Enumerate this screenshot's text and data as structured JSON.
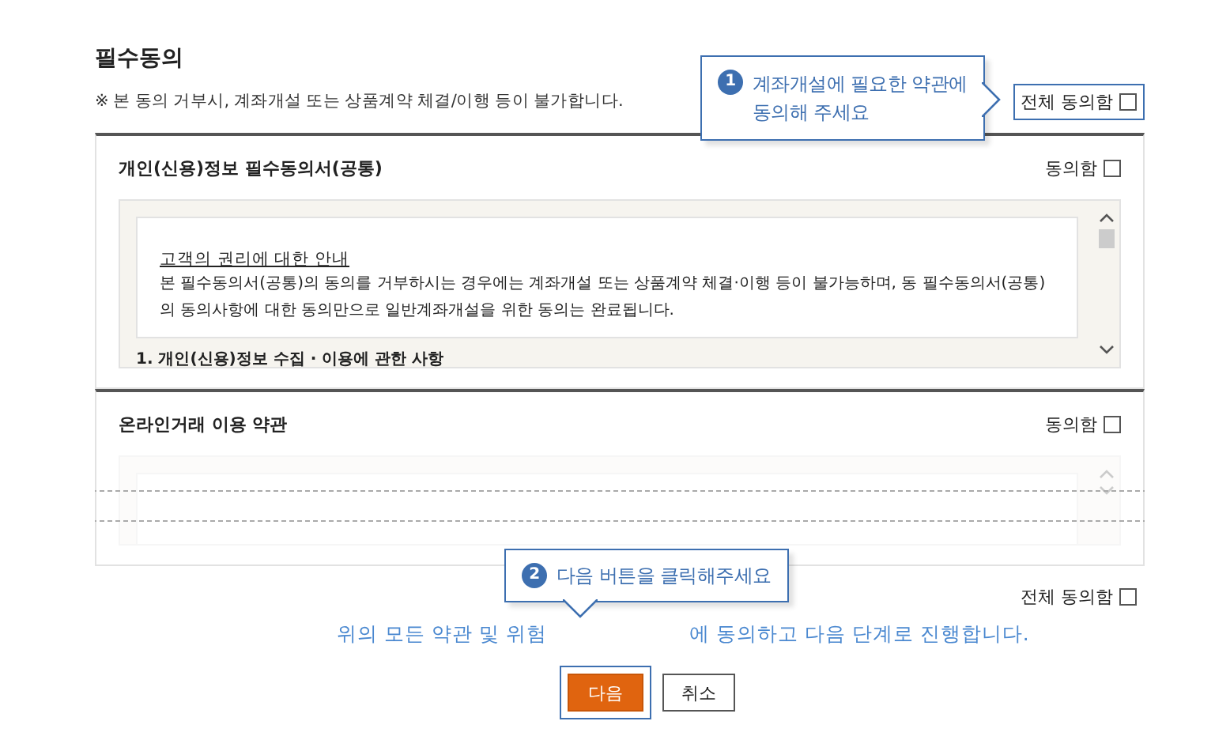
{
  "heading": "필수동의",
  "notice": "※ 본 동의 거부시, 계좌개설 또는 상품계약 체결/이행 등이 불가합니다.",
  "agree_all_top": {
    "label": "전체 동의함",
    "checked": false,
    "highlighted": true
  },
  "sections": [
    {
      "title": "개인(신용)정보 필수동의서(공통)",
      "agree": {
        "label": "동의함",
        "checked": false
      },
      "faded": false,
      "content": {
        "link": "고객의 권리에 대한 안내",
        "body": "본 필수동의서(공통)의 동의를 거부하시는 경우에는 계좌개설 또는 상품계약 체결·이행 등이 불가능하며, 동 필수동의서(공통)의 동의사항에 대한 동의만으로 일반계좌개설을 위한 동의는 완료됩니다.",
        "subheading": "1. 개인(신용)정보 수집 · 이용에 관한 사항"
      }
    },
    {
      "title": "온라인거래 이용 약관",
      "agree": {
        "label": "동의함",
        "checked": false
      },
      "faded": true
    }
  ],
  "agree_all_bottom": {
    "label": "전체 동의함",
    "checked": false,
    "highlighted": false
  },
  "proceed_text": [
    "위의 모든 약관 및 위험",
    "에 동의하고 다음 단계로 진행합니다."
  ],
  "buttons": [
    {
      "label": "다음",
      "kind": "primary",
      "highlighted": true
    },
    {
      "label": "취소",
      "kind": "secondary",
      "highlighted": false
    }
  ],
  "tooltips": [
    {
      "number": "1",
      "lines": [
        "계좌개설에 필요한 약관에",
        "동의해 주세요"
      ]
    },
    {
      "number": "2",
      "lines": [
        "다음 버튼을 클릭해주세요"
      ]
    }
  ]
}
